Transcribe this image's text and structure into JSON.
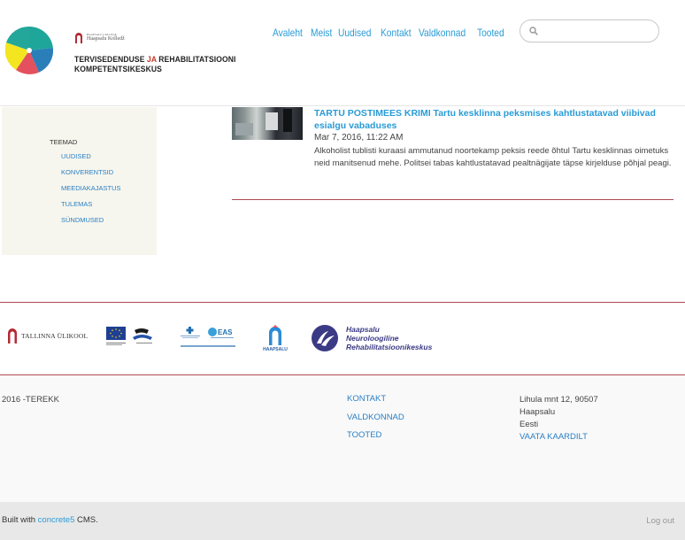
{
  "header": {
    "college": {
      "small": "HAAPSALU COLLEGE",
      "name": "Haapsalu Kolledž"
    },
    "brand": {
      "line1a": "TERVISEDENDUSE",
      "ja": "JA",
      "line1b": "REHABILITATSIOONI",
      "line2": "KOMPETENTSIKESKUS"
    },
    "nav": [
      "Avaleht",
      "Meist",
      "Uudised",
      "Kontakt",
      "Valdkonnad",
      "Tooted"
    ],
    "search": {
      "placeholder": "",
      "value": ""
    }
  },
  "sidebar": {
    "title": "TEEMAD",
    "items": [
      "UUDISED",
      "KONVERENTSID",
      "MEEDIAKAJASTUS",
      "TULEMAS",
      "SÜNDMUSED"
    ]
  },
  "article": {
    "title": "TARTU POSTIMEES KRIMI Tartu kesklinna peksmises kahtlustatavad viibivad esialgu vabaduses",
    "date": "Mar 7, 2016, 11:22 AM",
    "body": "Alkoholist tublisti kuraasi ammutanud noortekamp peksis reede õhtul Tartu kesklinnas oimetuks neid manitsenud mehe. Politsei tabas kahtlustatavad pealtnägijate täpse kirjelduse põhjal peagi."
  },
  "partners": {
    "tlu": "TALLINNA ÜLIKOOL",
    "haapsalu": "HAAPSALU",
    "neuro": [
      "Haapsalu",
      "Neuroloogiline",
      "Rehabilitatsioonikeskus"
    ]
  },
  "footer": {
    "copyright": "2016 -TEREKK",
    "links": [
      "KONTAKT",
      "VALDKONNAD",
      "TOOTED"
    ],
    "address": [
      "Lihula mnt 12, 90507",
      "Haapsalu",
      "Eesti"
    ],
    "map_link": "VAATA KAARDILT"
  },
  "bottombar": {
    "built_prefix": "Built with ",
    "cms_link": "concrete5",
    "built_suffix": " CMS.",
    "logout": "Log out"
  },
  "colors": {
    "accent": "#2a9bd6",
    "link": "#2a7fc4",
    "divider": "#b0484f",
    "brand_red": "#c0392b"
  }
}
